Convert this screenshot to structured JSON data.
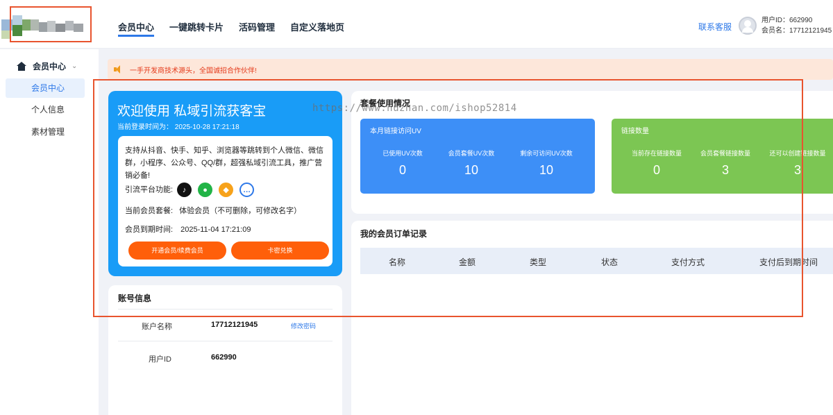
{
  "header": {
    "nav": [
      "会员中心",
      "一键跳转卡片",
      "活码管理",
      "自定义落地页"
    ],
    "contact": "联系客服",
    "user_id_line": "用户ID：662990",
    "user_name_line": "会员名：17712121945"
  },
  "sidebar": {
    "group": "会员中心",
    "items": [
      "会员中心",
      "个人信息",
      "素材管理"
    ]
  },
  "notice": "一手开发商技术源头，全国诚招合作伙伴!",
  "welcome": {
    "title": "欢迎使用 私域引流获客宝",
    "login_time": "当前登录时间为：  2025-10-28 17:21:18",
    "desc": "支持从抖音、快手、知乎、浏览器等跳转到个人微信、微信群，小程序、公众号、QQ/群，超强私域引流工具，推广营销必备!",
    "platform_label": "引流平台功能:",
    "plan_label": "当前会员套餐:",
    "plan_value": "体验会员（不可删除，可修改名字）",
    "expire_label": "会员到期时间:",
    "expire_value": "2025-11-04 17:21:09",
    "btn_open": "开通会员/续费会员",
    "btn_card": "卡密兑换"
  },
  "account": {
    "title": "账号信息",
    "name_label": "账户名称",
    "name_value": "17712121945",
    "change_pwd": "修改密码",
    "id_label": "用户ID",
    "id_value": "662990"
  },
  "usage": {
    "title": "套餐使用情况",
    "uv_card": {
      "title": "本月链接访问UV",
      "stats": [
        {
          "label": "已使用UV次数",
          "value": "0"
        },
        {
          "label": "会员套餐UV次数",
          "value": "10"
        },
        {
          "label": "剩余可访问UV次数",
          "value": "10"
        }
      ]
    },
    "link_card": {
      "title": "链接数量",
      "stats": [
        {
          "label": "当前存在链接数量",
          "value": "0"
        },
        {
          "label": "会员套餐链接数量",
          "value": "3"
        },
        {
          "label": "还可以创建链接数量",
          "value": "3"
        }
      ]
    }
  },
  "orders": {
    "title": "我的会员订单记录",
    "columns": [
      "名称",
      "金额",
      "类型",
      "状态",
      "支付方式",
      "支付后到期时间"
    ]
  },
  "watermark": "https://www.huzhan.com/ishop52814",
  "colors": {
    "primary": "#199cf7",
    "uv_card": "#3d8ff7",
    "link_card": "#7cc653",
    "button": "#ff5f0a",
    "accent": "#2d78e8"
  }
}
